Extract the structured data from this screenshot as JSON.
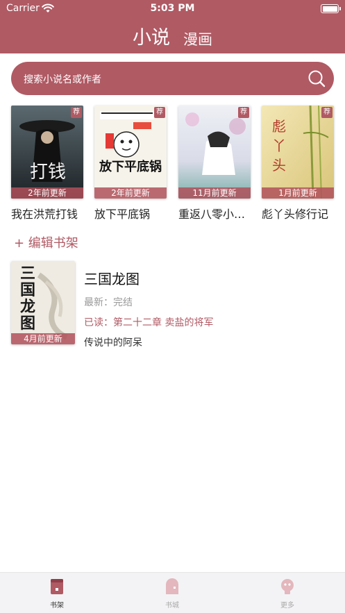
{
  "status_bar": {
    "carrier": "Carrier",
    "time": "5:03 PM"
  },
  "header": {
    "tabs": [
      {
        "label": "小说"
      },
      {
        "label": "漫画"
      }
    ]
  },
  "search": {
    "placeholder": "搜索小说名或作者"
  },
  "shelf": {
    "recommend_badge": "荐",
    "books": [
      {
        "title": "我在洪荒打钱",
        "update": "2年前更新",
        "cover_text": "打钱"
      },
      {
        "title": "放下平底锅",
        "update": "2年前更新",
        "cover_text": "放下平底锅"
      },
      {
        "title": "重返八零小…",
        "update": "11月前更新",
        "cover_text": ""
      },
      {
        "title": "彪丫头修行记",
        "update": "1月前更新",
        "cover_text": "彪丫头"
      }
    ]
  },
  "edit_shelf": {
    "label": "+ 编辑书架"
  },
  "reading": {
    "title": "三国龙图",
    "latest": "最新：完结",
    "read": "已读：第二十二章 卖盐的将军",
    "author": "传说中的阿呆",
    "update": "4月前更新",
    "cover_text": "三国龙图"
  },
  "tabbar": {
    "items": [
      {
        "label": "书架"
      },
      {
        "label": "书城"
      },
      {
        "label": "更多"
      }
    ]
  },
  "colors": {
    "accent": "#b05a64",
    "tabbar_bg": "#f3f3f5"
  }
}
